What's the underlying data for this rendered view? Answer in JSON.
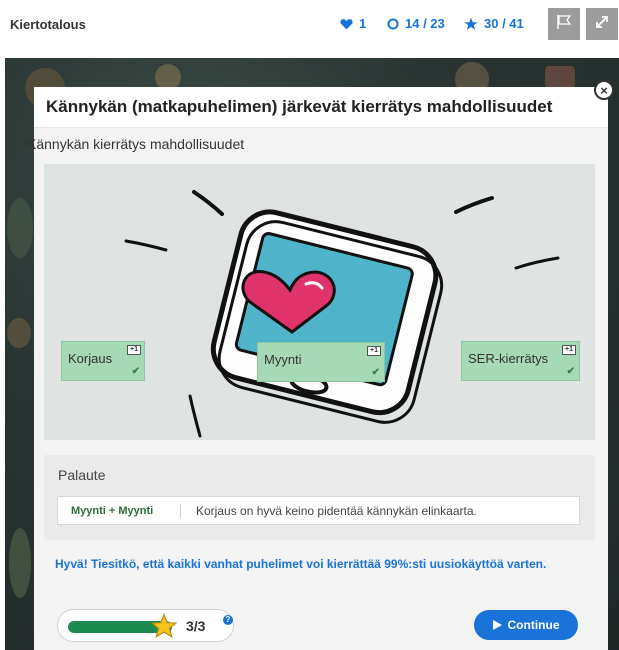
{
  "header": {
    "title": "Kiertotalous",
    "lives": "1",
    "tasks": "14 / 23",
    "stars": "30 / 41",
    "colors": {
      "accent": "#1a73d9",
      "button_bg": "#9c9c9c"
    },
    "icons": [
      "heart-icon",
      "circle-icon",
      "star-icon",
      "flag-icon",
      "expand-icon"
    ]
  },
  "modal": {
    "title": "Kännykän (matkapuhelimen) järkevät kierrätys mahdollisuudet",
    "subheading": "Kännykän kierrätys mahdollisuudet",
    "drop_zones": [
      {
        "label": "Korjaus",
        "badge": "+1"
      },
      {
        "label": "Myynti",
        "badge": "+1"
      },
      {
        "label": "SER-kierrätys",
        "badge": "+1"
      }
    ],
    "feedback": {
      "title": "Palaute",
      "pair": "Myynti + Myynti",
      "message": "Korjaus on hyvä keino pidentää kännykän elinkaarta."
    },
    "info": "Hyvä! Tiesitkö, että kaikki vanhat puhelimet voi kierrättää 99%:sti uusiokäyttöä varten.",
    "progress": {
      "score": "3/3",
      "fraction": 1.0
    },
    "continue_label": "Continue",
    "colors": {
      "drop_bg": "#a6d9b6",
      "progress": "#1d8a4f",
      "heart": "#e0336b",
      "screen": "#4fb4c9"
    }
  }
}
